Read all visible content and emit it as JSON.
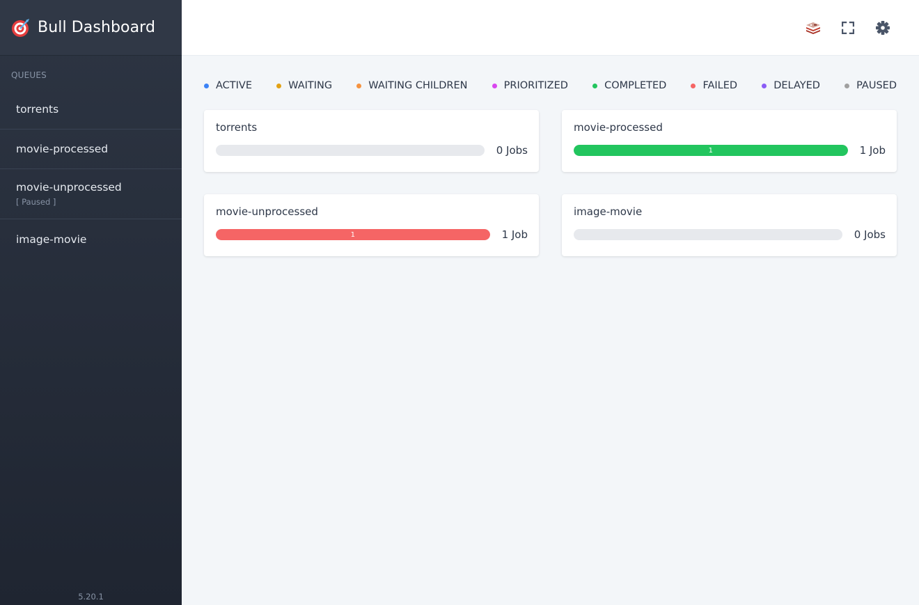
{
  "sidebar": {
    "title": "Bull Dashboard",
    "section_label": "QUEUES",
    "items": [
      {
        "name": "torrents",
        "status": ""
      },
      {
        "name": "movie-processed",
        "status": ""
      },
      {
        "name": "movie-unprocessed",
        "status": "[ Paused ]"
      },
      {
        "name": "image-movie",
        "status": ""
      }
    ],
    "version": "5.20.1"
  },
  "header": {
    "icons": [
      "redis-icon",
      "fullscreen-icon",
      "settings-icon"
    ]
  },
  "legend": [
    {
      "label": "ACTIVE",
      "color": "#3b82f6"
    },
    {
      "label": "WAITING",
      "color": "#e2a215"
    },
    {
      "label": "WAITING CHILDREN",
      "color": "#f59340"
    },
    {
      "label": "PRIORITIZED",
      "color": "#d946ef"
    },
    {
      "label": "COMPLETED",
      "color": "#22c55e"
    },
    {
      "label": "FAILED",
      "color": "#f56565"
    },
    {
      "label": "DELAYED",
      "color": "#8b5cf6"
    },
    {
      "label": "PAUSED",
      "color": "#a0a0a0"
    }
  ],
  "cards": [
    {
      "title": "torrents",
      "count_label": "0 Jobs",
      "fill_fraction": 0,
      "fill_label": "",
      "fill_color": ""
    },
    {
      "title": "movie-processed",
      "count_label": "1 Job",
      "fill_fraction": 1,
      "fill_label": "1",
      "fill_color": "#22c55e"
    },
    {
      "title": "movie-unprocessed",
      "count_label": "1 Job",
      "fill_fraction": 1,
      "fill_label": "1",
      "fill_color": "#f56565"
    },
    {
      "title": "image-movie",
      "count_label": "0 Jobs",
      "fill_fraction": 0,
      "fill_label": "",
      "fill_color": ""
    }
  ]
}
